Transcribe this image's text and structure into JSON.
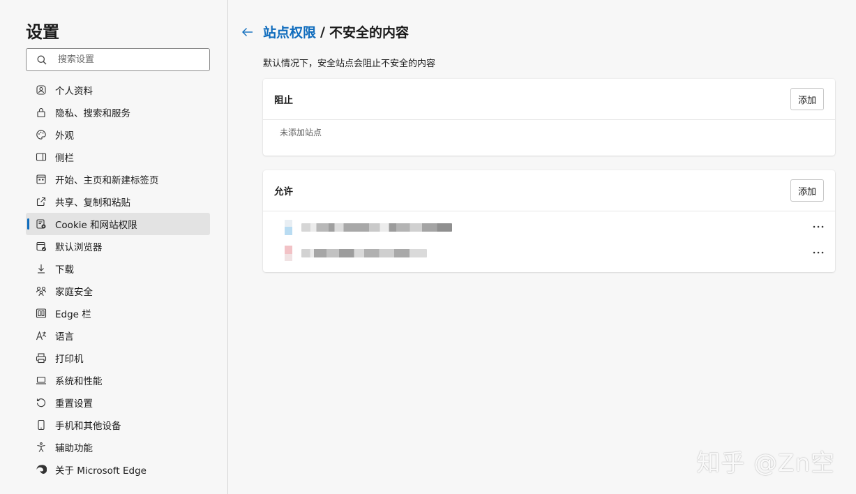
{
  "sidebar": {
    "title": "设置",
    "search": {
      "placeholder": "搜索设置",
      "value": ""
    },
    "items": [
      {
        "label": "个人资料",
        "icon": "profile-icon"
      },
      {
        "label": "隐私、搜索和服务",
        "icon": "lock-icon"
      },
      {
        "label": "外观",
        "icon": "palette-icon"
      },
      {
        "label": "侧栏",
        "icon": "sidebar-icon"
      },
      {
        "label": "开始、主页和新建标签页",
        "icon": "home-grid-icon"
      },
      {
        "label": "共享、复制和粘贴",
        "icon": "share-icon"
      },
      {
        "label": "Cookie 和网站权限",
        "icon": "cookie-permissions-icon",
        "active": true
      },
      {
        "label": "默认浏览器",
        "icon": "browser-icon"
      },
      {
        "label": "下载",
        "icon": "download-icon"
      },
      {
        "label": "家庭安全",
        "icon": "family-icon"
      },
      {
        "label": "Edge 栏",
        "icon": "edge-bar-icon"
      },
      {
        "label": "语言",
        "icon": "language-icon"
      },
      {
        "label": "打印机",
        "icon": "printer-icon"
      },
      {
        "label": "系统和性能",
        "icon": "laptop-icon"
      },
      {
        "label": "重置设置",
        "icon": "reset-icon"
      },
      {
        "label": "手机和其他设备",
        "icon": "phone-icon"
      },
      {
        "label": "辅助功能",
        "icon": "accessibility-icon"
      },
      {
        "label": "关于 Microsoft Edge",
        "icon": "edge-logo-icon"
      }
    ]
  },
  "main": {
    "breadcrumb": {
      "parent": "站点权限",
      "separator": "/",
      "current": "不安全的内容"
    },
    "description": "默认情况下，安全站点会阻止不安全的内容",
    "block": {
      "title": "阻止",
      "add_label": "添加",
      "empty_text": "未添加站点"
    },
    "allow": {
      "title": "允许",
      "add_label": "添加",
      "sites": [
        {
          "favicon_color": "#b9dcf2"
        },
        {
          "favicon_color": "#f2c2c6"
        }
      ]
    }
  },
  "watermark": "知乎 @Zn空",
  "colors": {
    "accent": "#0f6cbd",
    "background": "#f7f7f7"
  }
}
